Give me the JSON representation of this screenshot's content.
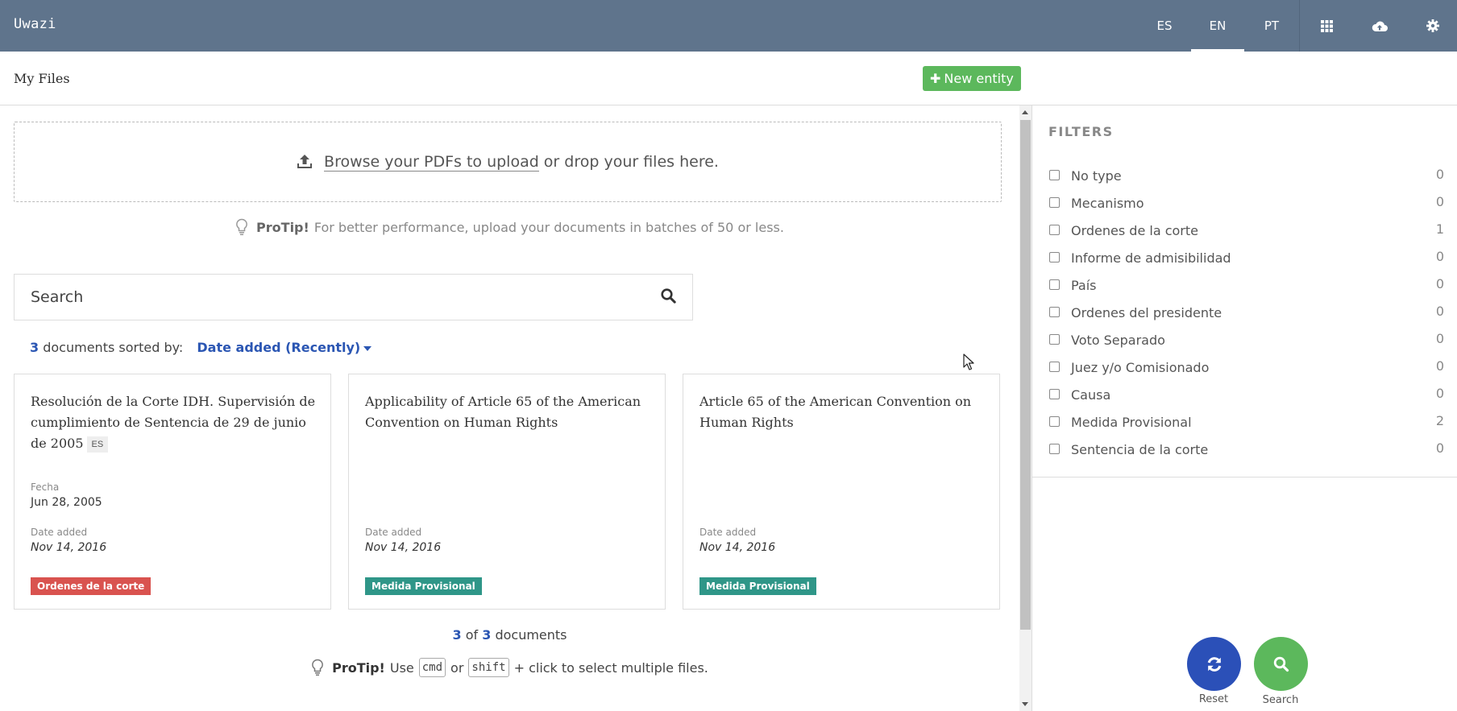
{
  "navbar": {
    "brand": "Uwazi",
    "languages": [
      {
        "code": "ES",
        "active": false
      },
      {
        "code": "EN",
        "active": true
      },
      {
        "code": "PT",
        "active": false
      }
    ],
    "icons": [
      "grid-icon",
      "cloud-upload-icon",
      "gear-icon"
    ]
  },
  "header": {
    "title": "My Files",
    "new_entity_label": "New entity"
  },
  "upload": {
    "browse_label": "Browse your PDFs to upload",
    "drop_label": "or drop your files here."
  },
  "protip_top": {
    "label": "ProTip!",
    "text": "For better performance, upload your documents in batches of 50 or less."
  },
  "search": {
    "placeholder": "Search"
  },
  "sort": {
    "count": "3",
    "text": "documents sorted by:",
    "sort_by": "Date added (Recently)"
  },
  "documents": [
    {
      "title": "Resolución de la Corte IDH. Supervisión de cumplimiento de Sentencia de 29 de junio de 2005",
      "language": "ES",
      "meta": [
        {
          "label": "Fecha",
          "value": "Jun 28, 2005"
        },
        {
          "label": "Date added",
          "value": "Nov 14, 2016"
        }
      ],
      "type": "Ordenes de la corte",
      "type_color": "#d9534f"
    },
    {
      "title": "Applicability of Article 65 of the American Convention on Human Rights",
      "meta": [
        {
          "label": "Date added",
          "value": "Nov 14, 2016"
        }
      ],
      "type": "Medida Provisional",
      "type_color": "#2f9688"
    },
    {
      "title": "Article 65 of the American Convention on Human Rights",
      "meta": [
        {
          "label": "Date added",
          "value": "Nov 14, 2016"
        }
      ],
      "type": "Medida Provisional",
      "type_color": "#2f9688"
    }
  ],
  "pagination": {
    "shown": "3",
    "of": "of",
    "total": "3",
    "suffix": "documents"
  },
  "protip_bottom": {
    "label": "ProTip!",
    "use": "Use",
    "key1": "cmd",
    "or": "or",
    "key2": "shift",
    "suffix": "+ click to select multiple files."
  },
  "filters": {
    "title": "FILTERS",
    "items": [
      {
        "label": "No type",
        "count": "0"
      },
      {
        "label": "Mecanismo",
        "count": "0"
      },
      {
        "label": "Ordenes de la corte",
        "count": "1"
      },
      {
        "label": "Informe de admisibilidad",
        "count": "0"
      },
      {
        "label": "País",
        "count": "0"
      },
      {
        "label": "Ordenes del presidente",
        "count": "0"
      },
      {
        "label": "Voto Separado",
        "count": "0"
      },
      {
        "label": "Juez y/o Comisionado",
        "count": "0"
      },
      {
        "label": "Causa",
        "count": "0"
      },
      {
        "label": "Medida Provisional",
        "count": "2"
      },
      {
        "label": "Sentencia de la corte",
        "count": "0"
      }
    ]
  },
  "actions": {
    "reset_label": "Reset",
    "search_label": "Search",
    "reset_color": "#2b50b8",
    "search_color": "#5cb85c"
  }
}
